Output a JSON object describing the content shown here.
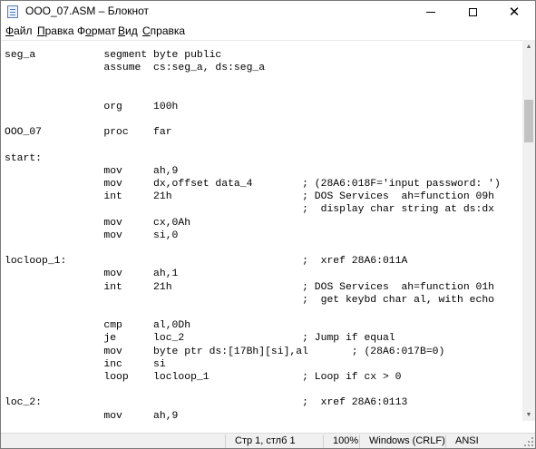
{
  "window": {
    "title": "OOO_07.ASM – Блокнот",
    "controls": {
      "minimize": "minimize",
      "maximize": "maximize",
      "close": "✕"
    }
  },
  "menu": [
    {
      "label": "Файл",
      "accel_index": 0
    },
    {
      "label": "Правка",
      "accel_index": 0
    },
    {
      "label": "Формат",
      "accel_index": 1
    },
    {
      "label": "Вид",
      "accel_index": 0
    },
    {
      "label": "Справка",
      "accel_index": 0
    }
  ],
  "editor": {
    "lines": [
      "seg_a           segment byte public",
      "                assume  cs:seg_a, ds:seg_a",
      "",
      "",
      "                org     100h",
      "",
      "OOO_07          proc    far",
      "",
      "start:",
      "                mov     ah,9",
      "                mov     dx,offset data_4        ; (28A6:018F='input password: ')",
      "                int     21h                     ; DOS Services  ah=function 09h",
      "                                                ;  display char string at ds:dx",
      "                mov     cx,0Ah",
      "                mov     si,0",
      "",
      "locloop_1:                                      ;  xref 28A6:011A",
      "                mov     ah,1",
      "                int     21h                     ; DOS Services  ah=function 01h",
      "                                                ;  get keybd char al, with echo",
      "",
      "                cmp     al,0Dh",
      "                je      loc_2                   ; Jump if equal",
      "                mov     byte ptr ds:[17Bh][si],al       ; (28A6:017B=0)",
      "                inc     si",
      "                loop    locloop_1               ; Loop if cx > 0",
      "",
      "loc_2:                                          ;  xref 28A6:0113",
      "                mov     ah,9"
    ]
  },
  "scrollbar": {
    "position": 0.15,
    "visible_fraction": 0.12
  },
  "status": {
    "position": "Стр 1, стлб 1",
    "zoom": "100%",
    "line_endings": "Windows (CRLF)",
    "encoding": "ANSI"
  }
}
